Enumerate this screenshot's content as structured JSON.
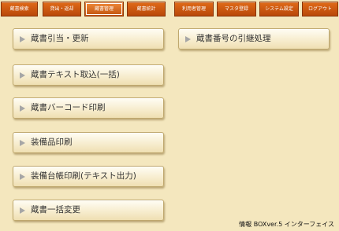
{
  "tabs": [
    {
      "label": "蔵書検索"
    },
    {
      "label": "貸出・返却"
    },
    {
      "label": "蔵書管理"
    },
    {
      "label": "蔵書統計"
    },
    {
      "label": "利用者管理"
    },
    {
      "label": "マスタ登録"
    },
    {
      "label": "システム設定"
    },
    {
      "label": "ログアウト"
    }
  ],
  "buttons_left": [
    {
      "label": "蔵書引当・更新"
    },
    {
      "label": "蔵書テキスト取込(一括)"
    },
    {
      "label": "蔵書バーコード印刷"
    },
    {
      "label": "装備品印刷"
    },
    {
      "label": "装備台帳印刷(テキスト出力)"
    },
    {
      "label": "蔵書一括変更"
    }
  ],
  "buttons_right": [
    {
      "label": "蔵書番号の引継処理"
    }
  ],
  "footer": "情報 BOXver.5 インターフェイス",
  "colors": {
    "tab": "#c8580f",
    "background": "#f4e7be",
    "arrow": "#a6a6a6"
  }
}
